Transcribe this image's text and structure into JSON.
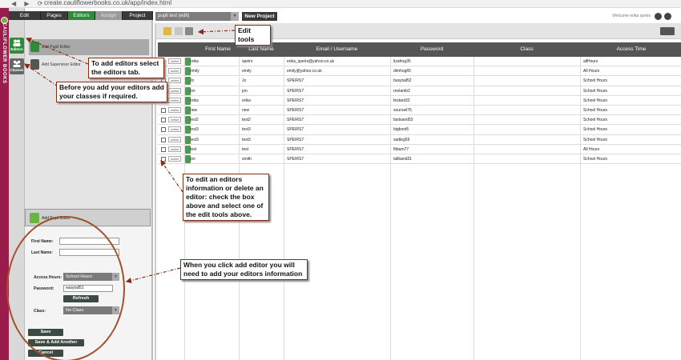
{
  "browser": {
    "url": "create.cauliflowerbooks.co.uk/app/index.html",
    "nav_glyphs": "◀ ▶ ⟳"
  },
  "brand": {
    "text": "CAULIFLOWER BOOKS"
  },
  "rail": {
    "editors": "Editors",
    "classes": "Classes"
  },
  "tabs": [
    {
      "label": "Edit",
      "state": "normal"
    },
    {
      "label": "Pages",
      "state": "normal"
    },
    {
      "label": "Editors",
      "state": "active"
    },
    {
      "label": "Assign",
      "state": "greyed"
    },
    {
      "label": "Project",
      "state": "normal"
    }
  ],
  "left_list": {
    "pupil": "Add Pupil Editor",
    "supervisor": "Add Supervisor Editor"
  },
  "form": {
    "header": "Add Pupil Editor",
    "first_name_label": "First Name:",
    "last_name_label": "Last Name:",
    "access_hours_label": "Access Hours:",
    "access_hours_value": "School Hours",
    "password_label": "Password:",
    "password_value": "easytail51",
    "refresh": "Refresh",
    "class_label": "Class:",
    "class_value": "No Class",
    "save": "Save",
    "save_add_another": "Save & Add Another",
    "cancel": "Cancel"
  },
  "topbar": {
    "project_select": "pupil test (edit)",
    "new_project": "New Project",
    "welcome": "Welcome erika speirs"
  },
  "table": {
    "headers": [
      "First Name",
      "Last Name",
      "Email / Username",
      "Password",
      "Class",
      "Access Time"
    ],
    "online_badge": "online",
    "rows": [
      {
        "first": "erika",
        "last": "speirs",
        "email": "erika_speirs@yahoo.co.uk",
        "password": "lizafrog35",
        "class": "",
        "access": "allHours",
        "checkbox": false
      },
      {
        "first": "emily",
        "last": "emily",
        "email": "emily@yahoo.co.uk",
        "password": "dimhog65",
        "class": "",
        "access": "All Hours",
        "checkbox": false
      },
      {
        "first": "Jo",
        "last": "Jo",
        "email": "SPEIRS7",
        "password": "busytail52",
        "class": "",
        "access": "School Hours",
        "checkbox": true
      },
      {
        "first": "jon",
        "last": "jon",
        "email": "SPEIRS7",
        "password": "reelamb2",
        "class": "",
        "access": "School Hours",
        "checkbox": true
      },
      {
        "first": "erika",
        "last": "erika",
        "email": "SPEIRS7",
        "password": "festant33",
        "class": "",
        "access": "School Hours",
        "checkbox": true
      },
      {
        "first": "new",
        "last": "new",
        "email": "SPEIRS7",
        "password": "sourowl76",
        "class": "",
        "access": "School Hours",
        "checkbox": true
      },
      {
        "first": "test2",
        "last": "test2",
        "email": "SPEIRS7",
        "password": "fastsand53",
        "class": "",
        "access": "School Hours",
        "checkbox": true
      },
      {
        "first": "test3",
        "last": "test3",
        "email": "SPEIRS7",
        "password": "bigboot5",
        "class": "",
        "access": "School Hours",
        "checkbox": true
      },
      {
        "first": "test3",
        "last": "test3",
        "email": "SPEIRS7",
        "password": "sadleg59",
        "class": "",
        "access": "School Hours",
        "checkbox": true
      },
      {
        "first": "test",
        "last": "test",
        "email": "SPEIRS7",
        "password": "fitbam77",
        "class": "",
        "access": "All Hours",
        "checkbox": true
      },
      {
        "first": "jon",
        "last": "smith",
        "email": "SPEIRS7",
        "password": "tallband31",
        "class": "",
        "access": "School Hours",
        "checkbox": true
      }
    ]
  },
  "callouts": {
    "edit_tools": "Edit tools",
    "editors_tab": "To add editors select the editors tab.",
    "classes": "Before you add your editors add your classes if required.",
    "edit_info": "To edit an editors information or delete an editor: check the box above and select one of the edit tools above.",
    "add_editor": "When you click add editor you will need to add your editors information"
  },
  "colors": {
    "brand": "#9a1c4b",
    "active_tab": "#2e8b3a",
    "header": "#555555",
    "callout_border": "#8a2a0f"
  }
}
